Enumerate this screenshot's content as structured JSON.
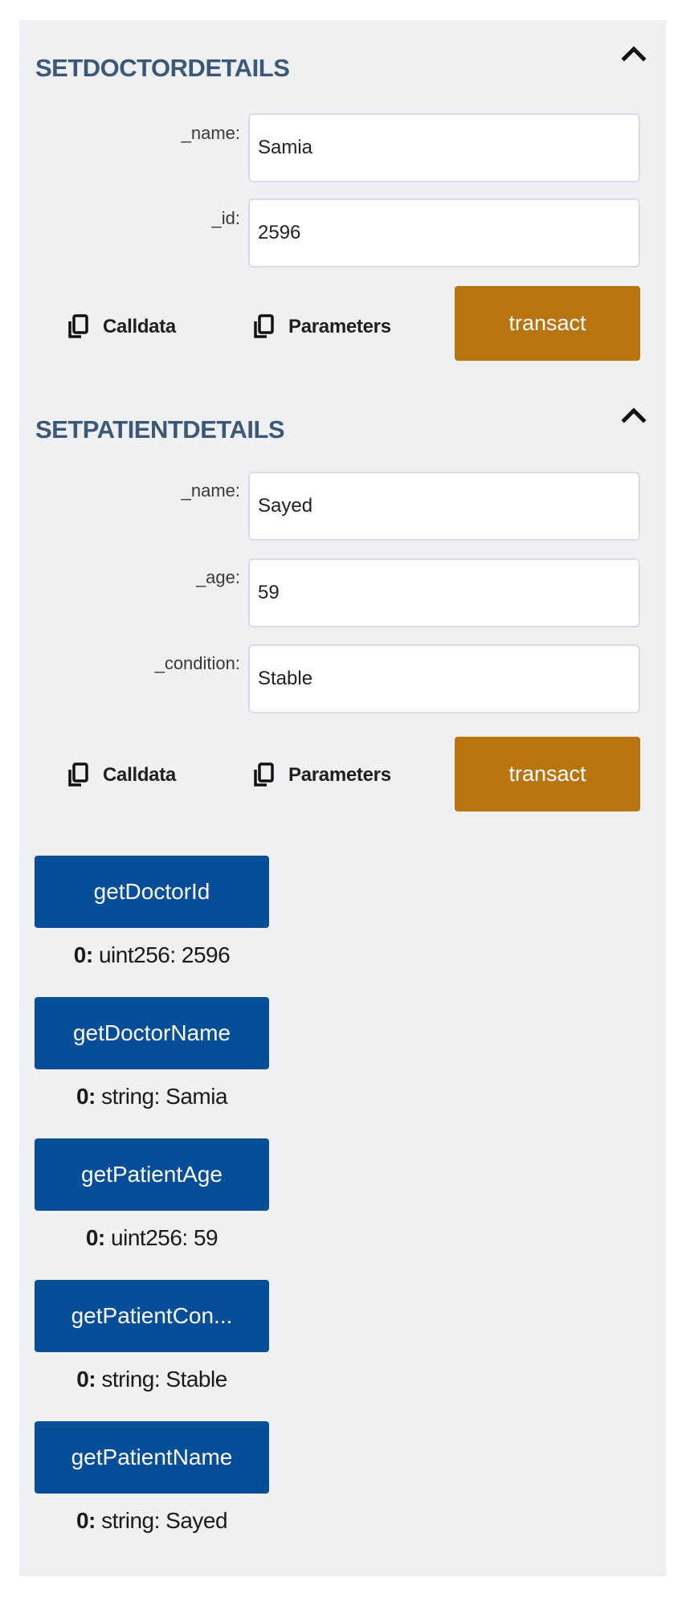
{
  "set_doctor": {
    "title": "SETDOCTORDETAILS",
    "collapse_icon": "chevron-up-icon",
    "fields": [
      {
        "label": "_name:",
        "value": "Samia"
      },
      {
        "label": "_id:",
        "value": "2596"
      }
    ],
    "calldata_label": "Calldata",
    "parameters_label": "Parameters",
    "transact_label": "transact"
  },
  "set_patient": {
    "title": "SETPATIENTDETAILS",
    "collapse_icon": "chevron-up-icon",
    "fields": [
      {
        "label": "_name:",
        "value": "Sayed"
      },
      {
        "label": "_age:",
        "value": "59"
      },
      {
        "label": "_condition:",
        "value": "Stable"
      }
    ],
    "calldata_label": "Calldata",
    "parameters_label": "Parameters",
    "transact_label": "transact"
  },
  "calls": [
    {
      "label": "getDoctorId",
      "result_index": "0:",
      "result_value": "uint256: 2596"
    },
    {
      "label": "getDoctorName",
      "result_index": "0:",
      "result_value": "string: Samia"
    },
    {
      "label": "getPatientAge",
      "result_index": "0:",
      "result_value": "uint256: 59"
    },
    {
      "label": "getPatientCon...",
      "result_index": "0:",
      "result_value": "string: Stable"
    },
    {
      "label": "getPatientName",
      "result_index": "0:",
      "result_value": "string: Sayed"
    }
  ],
  "colors": {
    "panel_bg": "#eef0f2",
    "title": "#3d5777",
    "transact": "#b7740f",
    "call_button": "#064e97"
  }
}
